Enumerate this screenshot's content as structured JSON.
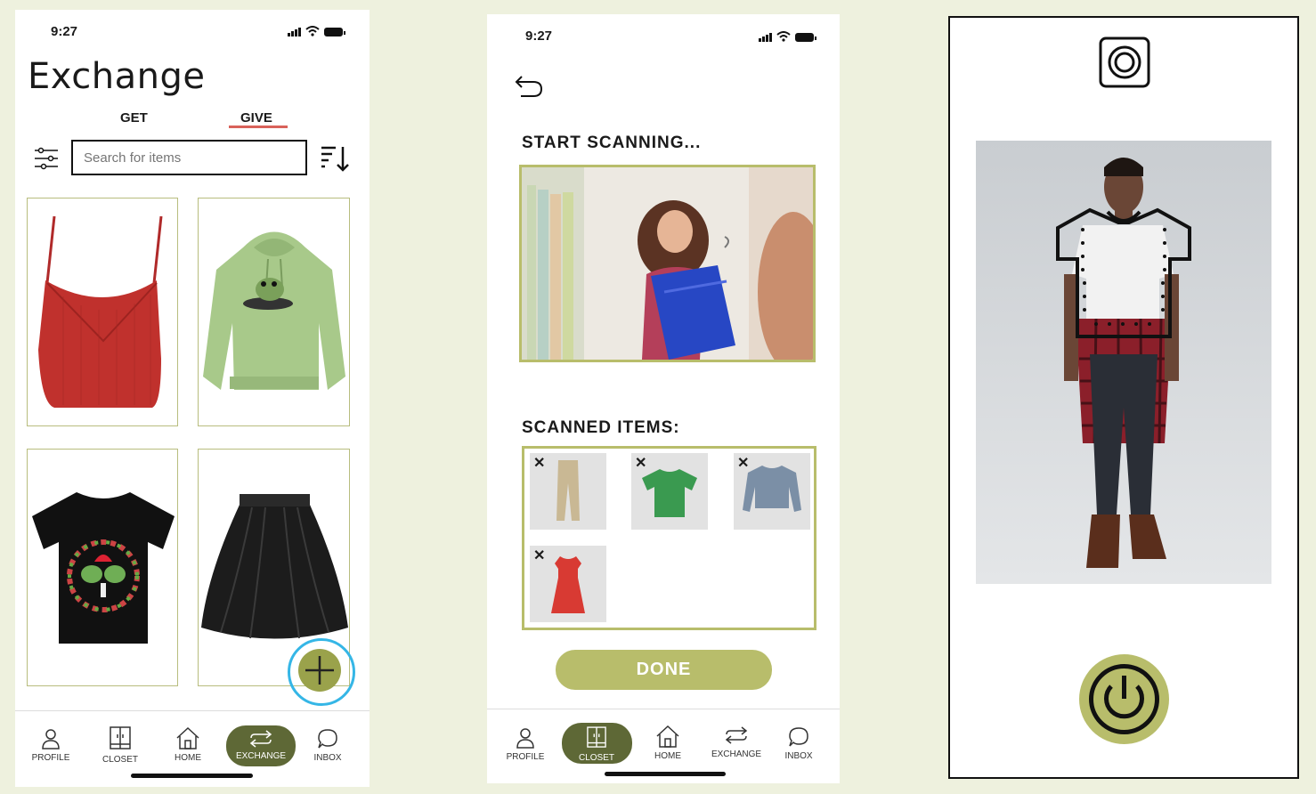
{
  "screen_give": {
    "status_time": "9:27",
    "title": "Exchange",
    "tabs": [
      {
        "label": "GET"
      },
      {
        "label": "GIVE"
      }
    ],
    "search": {
      "placeholder": "Search for items"
    },
    "items": [
      {
        "name": "Red ribbed camisole"
      },
      {
        "name": "Green frog hoodie"
      },
      {
        "name": "Black frog graphic tee"
      },
      {
        "name": "Black skater skirt"
      }
    ],
    "nav": [
      {
        "label": "PROFILE",
        "icon": "person-icon"
      },
      {
        "label": "CLOSET",
        "icon": "wardrobe-icon"
      },
      {
        "label": "HOME",
        "icon": "house-icon"
      },
      {
        "label": "EXCHANGE",
        "icon": "swap-icon"
      },
      {
        "label": "INBOX",
        "icon": "chat-bubble-icon"
      }
    ],
    "active_nav": "EXCHANGE",
    "colors": {
      "accent": "#5e6836",
      "tab_underline": "#d9625a",
      "fab": "#9aa24b",
      "fab_ring": "#35b6e6"
    }
  },
  "screen_scan": {
    "status_time": "9:27",
    "start_title": "START SCANNING...",
    "scanned_title": "SCANNED ITEMS:",
    "scanned_items": [
      {
        "name": "Beige trousers"
      },
      {
        "name": "Green t-shirt"
      },
      {
        "name": "Blue sweater"
      },
      {
        "name": "Red dress"
      }
    ],
    "remove_glyph": "✕",
    "done_label": "DONE",
    "nav": [
      {
        "label": "PROFILE",
        "icon": "person-icon"
      },
      {
        "label": "CLOSET",
        "icon": "wardrobe-icon"
      },
      {
        "label": "HOME",
        "icon": "house-icon"
      },
      {
        "label": "EXCHANGE",
        "icon": "swap-icon"
      },
      {
        "label": "INBOX",
        "icon": "chat-bubble-icon"
      }
    ],
    "active_nav": "CLOSET",
    "colors": {
      "accent": "#b8bd6b",
      "active_nav": "#5e6836"
    }
  },
  "screen_camera": {
    "icons": [
      "flip-camera-icon",
      "shutter-power-icon"
    ],
    "colors": {
      "shutter": "#b8bd6b"
    }
  }
}
